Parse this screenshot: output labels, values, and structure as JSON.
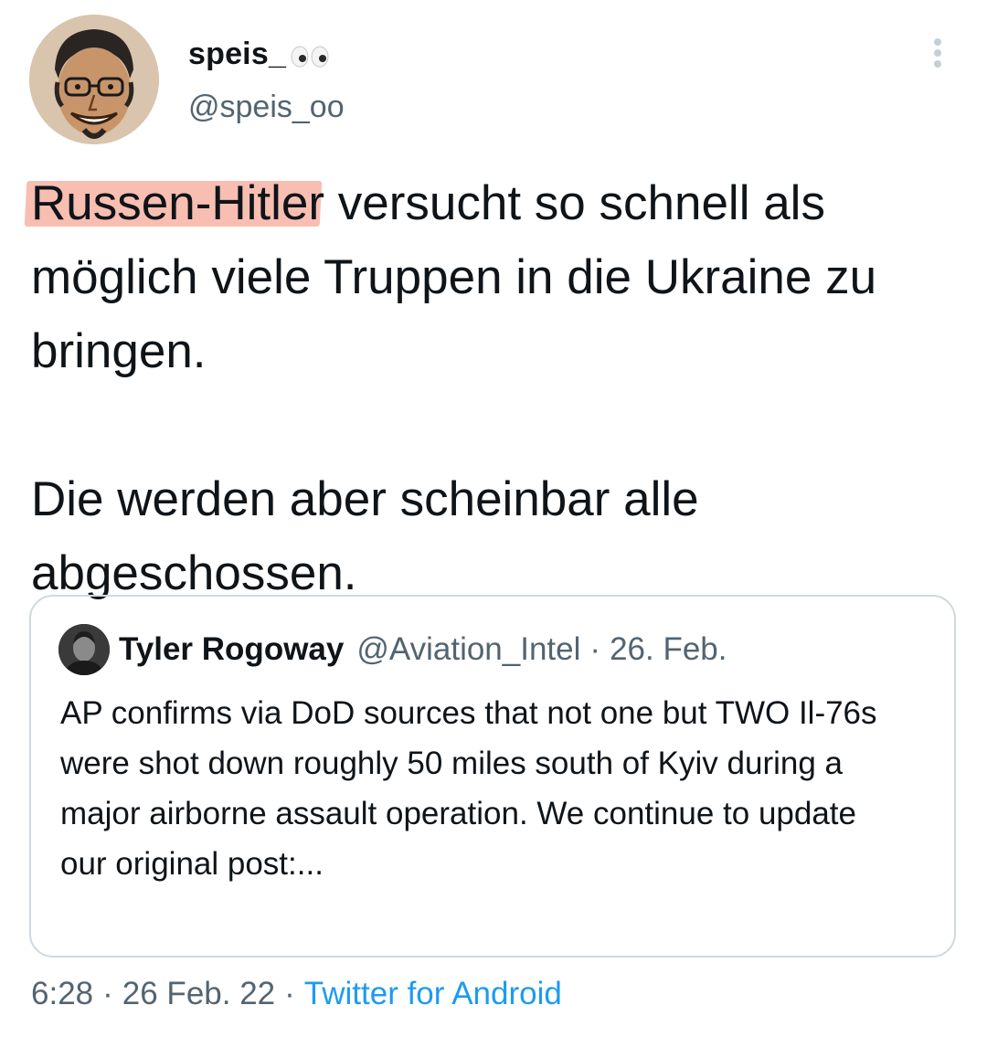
{
  "author": {
    "display_name": "speis_",
    "emoji_icon": "eyes-emoji-icon",
    "handle": "@speis_oo"
  },
  "tweet": {
    "highlighted_text": "Russen-Hitler",
    "text_after_highlight": " versucht so schnell als möglich viele Truppen in die Ukraine zu bringen.\n\nDie werden aber scheinbar alle abgeschossen.",
    "highlight_color": "#f7b3a4"
  },
  "quoted_tweet": {
    "author_name": "Tyler Rogoway",
    "author_handle": "@Aviation_Intel",
    "separator": "·",
    "date": "26. Feb.",
    "text": "AP confirms via DoD sources that not one but TWO Il-76s were shot down roughly 50 miles south of Kyiv during a major airborne assault operation. We continue to update our original post:..."
  },
  "meta": {
    "time": "6:28",
    "date": "26 Feb. 22",
    "separator": "·",
    "source": "Twitter for Android",
    "source_color": "#1d9bf0"
  },
  "icons": {
    "more": "more-vertical-icon"
  },
  "colors": {
    "text": "#0f1419",
    "secondary": "#536471",
    "border": "#cfd9de"
  }
}
